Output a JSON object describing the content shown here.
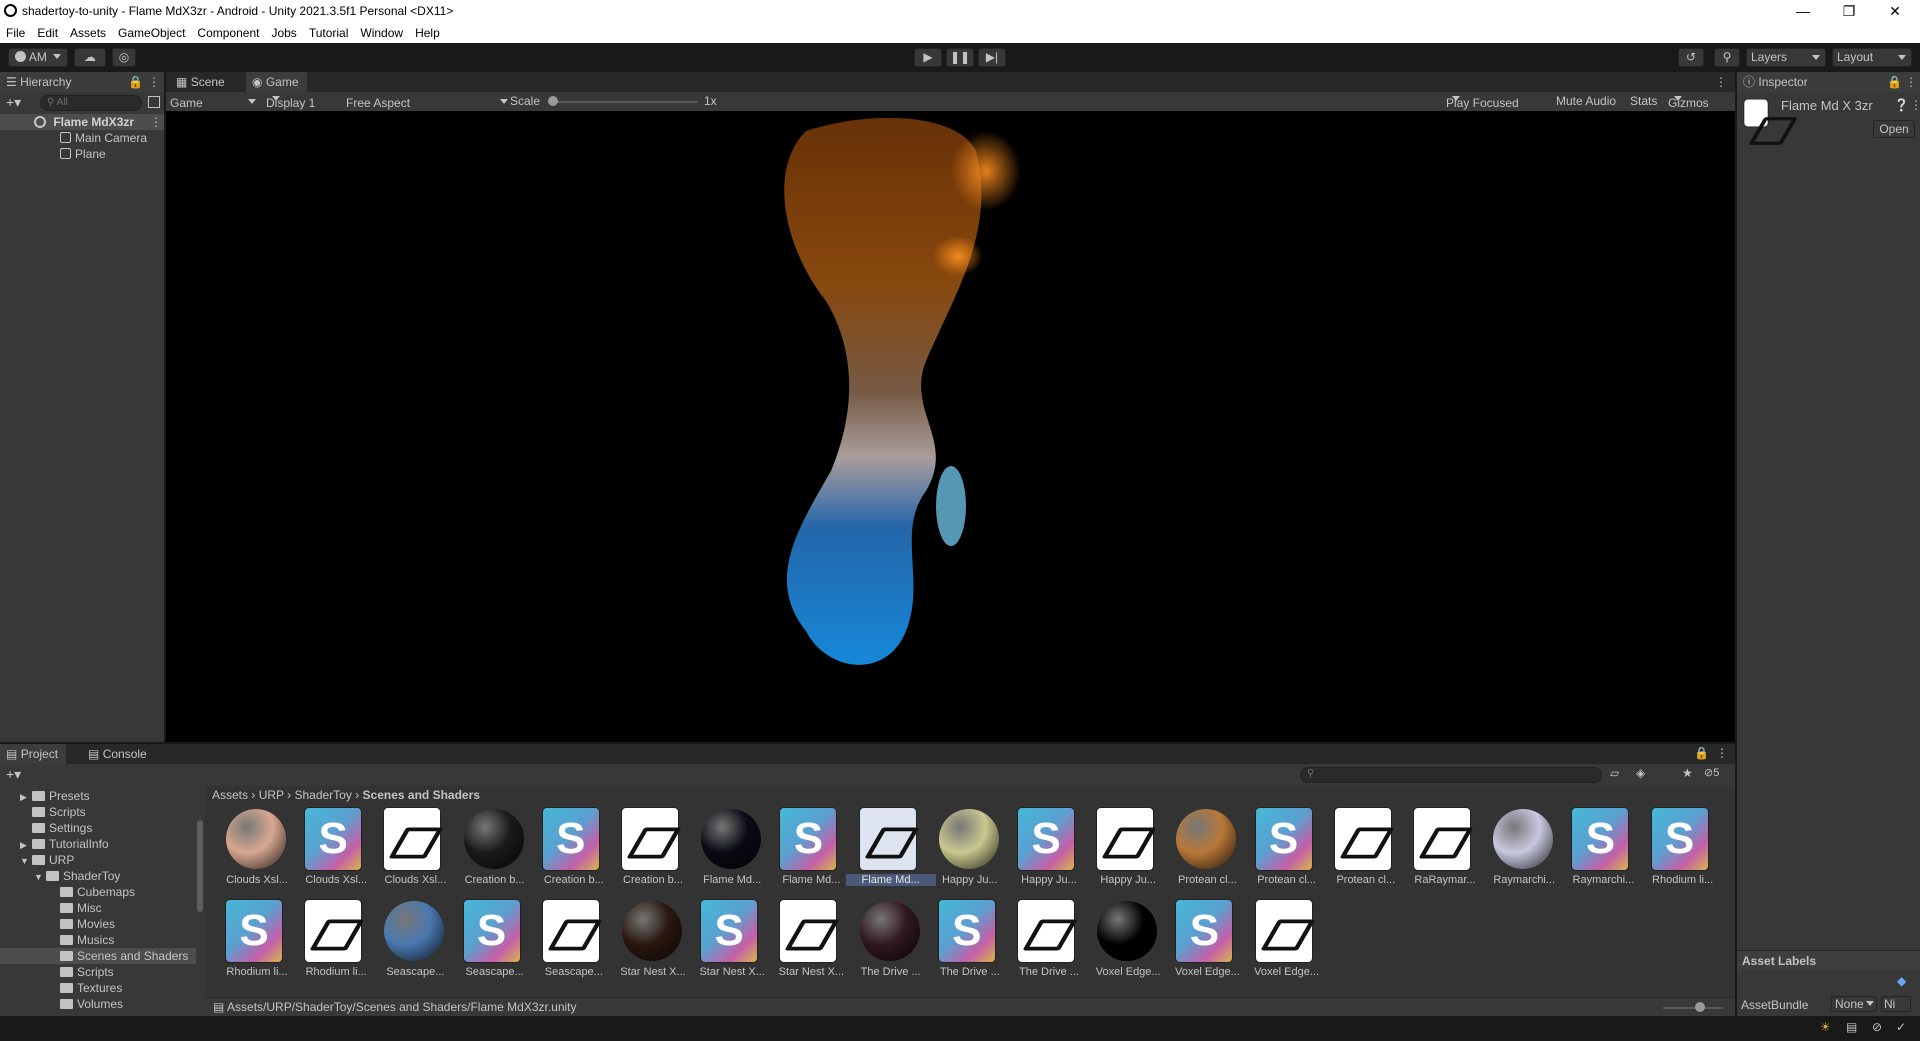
{
  "window": {
    "title": "shadertoy-to-unity - Flame MdX3zr - Android - Unity 2021.3.5f1 Personal <DX11>"
  },
  "menu": [
    "File",
    "Edit",
    "Assets",
    "GameObject",
    "Component",
    "Jobs",
    "Tutorial",
    "Window",
    "Help"
  ],
  "toolbar": {
    "account": "AM",
    "layers": "Layers",
    "layout": "Layout"
  },
  "hierarchy": {
    "tab": "Hierarchy",
    "search_placeholder": "All",
    "scene": "Flame MdX3zr",
    "items": [
      "Main Camera",
      "Plane"
    ]
  },
  "center_tabs": {
    "scene": "Scene",
    "game": "Game"
  },
  "gamebar": {
    "view": "Game",
    "display": "Display 1",
    "aspect": "Free Aspect",
    "scale_label": "Scale",
    "scale_value": "1x",
    "play_focused": "Play Focused",
    "mute": "Mute Audio",
    "stats": "Stats",
    "gizmos": "Gizmos"
  },
  "inspector": {
    "tab": "Inspector",
    "asset_name": "Flame Md X 3zr",
    "open": "Open",
    "asset_labels": "Asset Labels",
    "asset_bundle_label": "AssetBundle",
    "asset_bundle_value": "None",
    "asset_bundle_variant": "Ni"
  },
  "bottom_tabs": {
    "project": "Project",
    "console": "Console",
    "hidden_count": "5"
  },
  "project_tree": [
    {
      "label": "Presets",
      "depth": 1,
      "arrow": true
    },
    {
      "label": "Scripts",
      "depth": 1,
      "arrow": false
    },
    {
      "label": "Settings",
      "depth": 1,
      "arrow": false
    },
    {
      "label": "TutorialInfo",
      "depth": 1,
      "arrow": true
    },
    {
      "label": "URP",
      "depth": 1,
      "arrow": true,
      "open": true
    },
    {
      "label": "ShaderToy",
      "depth": 2,
      "arrow": true,
      "open": true
    },
    {
      "label": "Cubemaps",
      "depth": 3,
      "arrow": false
    },
    {
      "label": "Misc",
      "depth": 3,
      "arrow": false
    },
    {
      "label": "Movies",
      "depth": 3,
      "arrow": false
    },
    {
      "label": "Musics",
      "depth": 3,
      "arrow": false
    },
    {
      "label": "Scenes and Shaders",
      "depth": 3,
      "arrow": false,
      "selected": true
    },
    {
      "label": "Scripts",
      "depth": 3,
      "arrow": false
    },
    {
      "label": "Textures",
      "depth": 3,
      "arrow": false
    },
    {
      "label": "Volumes",
      "depth": 3,
      "arrow": false
    }
  ],
  "breadcrumb": [
    "Assets",
    "URP",
    "ShaderToy",
    "Scenes and Shaders"
  ],
  "assets": [
    {
      "label": "Clouds Xsl...",
      "kind": "sphere",
      "color": "#d8a890"
    },
    {
      "label": "Clouds Xsl...",
      "kind": "shader"
    },
    {
      "label": "Clouds Xsl...",
      "kind": "unity"
    },
    {
      "label": "Creation b...",
      "kind": "sphere",
      "color": "#1a1a1a"
    },
    {
      "label": "Creation b...",
      "kind": "shader"
    },
    {
      "label": "Creation b...",
      "kind": "unity"
    },
    {
      "label": "Flame Md...",
      "kind": "sphere",
      "color": "#0a0a14"
    },
    {
      "label": "Flame Md...",
      "kind": "shader"
    },
    {
      "label": "Flame Md...",
      "kind": "unity",
      "selected": true
    },
    {
      "label": "Happy Ju...",
      "kind": "sphere",
      "color": "#c8c890"
    },
    {
      "label": "Happy Ju...",
      "kind": "shader"
    },
    {
      "label": "Happy Ju...",
      "kind": "unity"
    },
    {
      "label": "Protean cl...",
      "kind": "sphere",
      "color": "#b87838"
    },
    {
      "label": "Protean cl...",
      "kind": "shader"
    },
    {
      "label": "Protean cl...",
      "kind": "unity"
    },
    {
      "label": "RaRaymar...",
      "kind": "unity"
    },
    {
      "label": "Raymarchi...",
      "kind": "sphere",
      "color": "#c8c8e0"
    },
    {
      "label": "Raymarchi...",
      "kind": "shader"
    },
    {
      "label": "Rhodium li...",
      "kind": "shader"
    },
    {
      "label": "Rhodium li...",
      "kind": "shader"
    },
    {
      "label": "Rhodium li...",
      "kind": "unity"
    },
    {
      "label": "Seascape...",
      "kind": "sphere",
      "color": "#4a78b0"
    },
    {
      "label": "Seascape...",
      "kind": "shader"
    },
    {
      "label": "Seascape...",
      "kind": "unity"
    },
    {
      "label": "Star Nest X...",
      "kind": "sphere",
      "color": "#2a1810"
    },
    {
      "label": "Star Nest X...",
      "kind": "shader"
    },
    {
      "label": "Star Nest X...",
      "kind": "unity"
    },
    {
      "label": "The Drive ...",
      "kind": "sphere",
      "color": "#301820"
    },
    {
      "label": "The Drive ...",
      "kind": "shader"
    },
    {
      "label": "The Drive ...",
      "kind": "unity"
    },
    {
      "label": "Voxel Edge...",
      "kind": "sphere",
      "color": "#000000"
    },
    {
      "label": "Voxel Edge...",
      "kind": "shader"
    },
    {
      "label": "Voxel Edge...",
      "kind": "unity"
    }
  ],
  "status_path": "Assets/URP/ShaderToy/Scenes and Shaders/Flame MdX3zr.unity"
}
